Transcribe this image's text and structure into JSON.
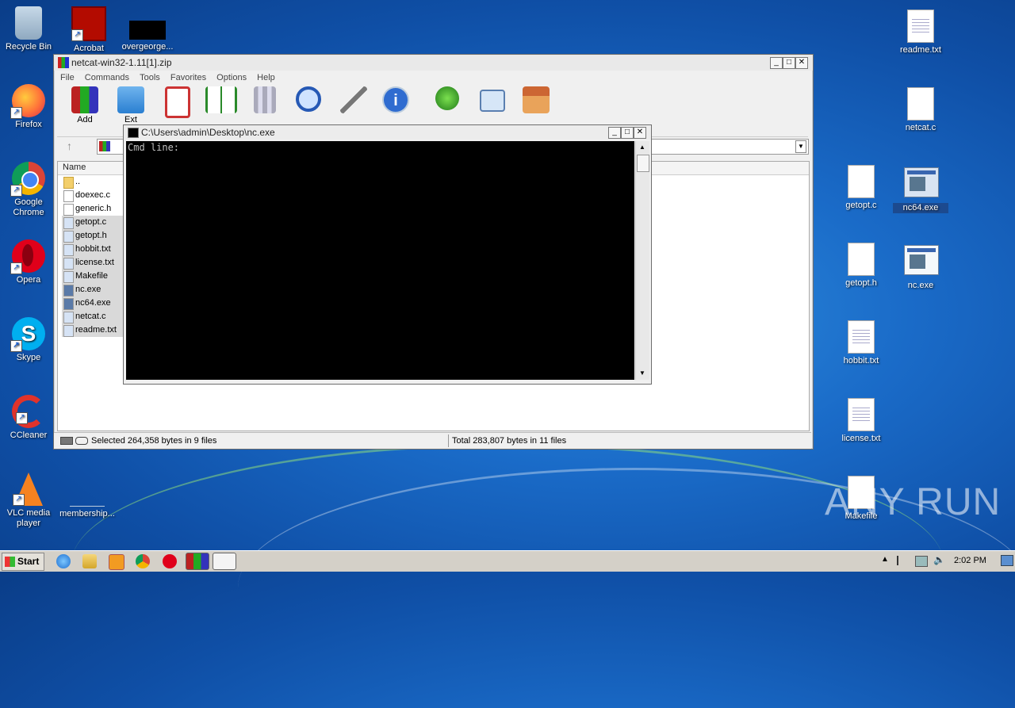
{
  "desktop": {
    "icons": {
      "recycle_bin": "Recycle Bin",
      "acrobat": "Acrobat",
      "overgeorge": "overgeorge...",
      "firefox": "Firefox",
      "chrome": "Google Chrome",
      "opera": "Opera",
      "skype": "Skype",
      "ccleaner": "CCleaner",
      "vlc": "VLC media player",
      "membership": "membership...",
      "readme": "readme.txt",
      "netcat_c": "netcat.c",
      "getopt_c": "getopt.c",
      "nc64": "nc64.exe",
      "getopt_h": "getopt.h",
      "nc_exe": "nc.exe",
      "hobbit": "hobbit.txt",
      "license": "license.txt",
      "makefile": "Makefile"
    }
  },
  "winrar": {
    "title": "netcat-win32-1.11[1].zip",
    "menu": [
      "File",
      "Commands",
      "Tools",
      "Favorites",
      "Options",
      "Help"
    ],
    "toolbar": {
      "add": "Add",
      "extract": "Ext"
    },
    "column_name": "Name",
    "files": [
      "..",
      "doexec.c",
      "generic.h",
      "getopt.c",
      "getopt.h",
      "hobbit.txt",
      "license.txt",
      "Makefile",
      "nc.exe",
      "nc64.exe",
      "netcat.c",
      "readme.txt"
    ],
    "status_left": "Selected 264,358 bytes in 9 files",
    "status_right": "Total 283,807 bytes in 11 files"
  },
  "console": {
    "title": "C:\\Users\\admin\\Desktop\\nc.exe",
    "line": "Cmd line:"
  },
  "taskbar": {
    "start": "Start",
    "clock": "2:02 PM"
  },
  "watermark": "ANY RUN"
}
